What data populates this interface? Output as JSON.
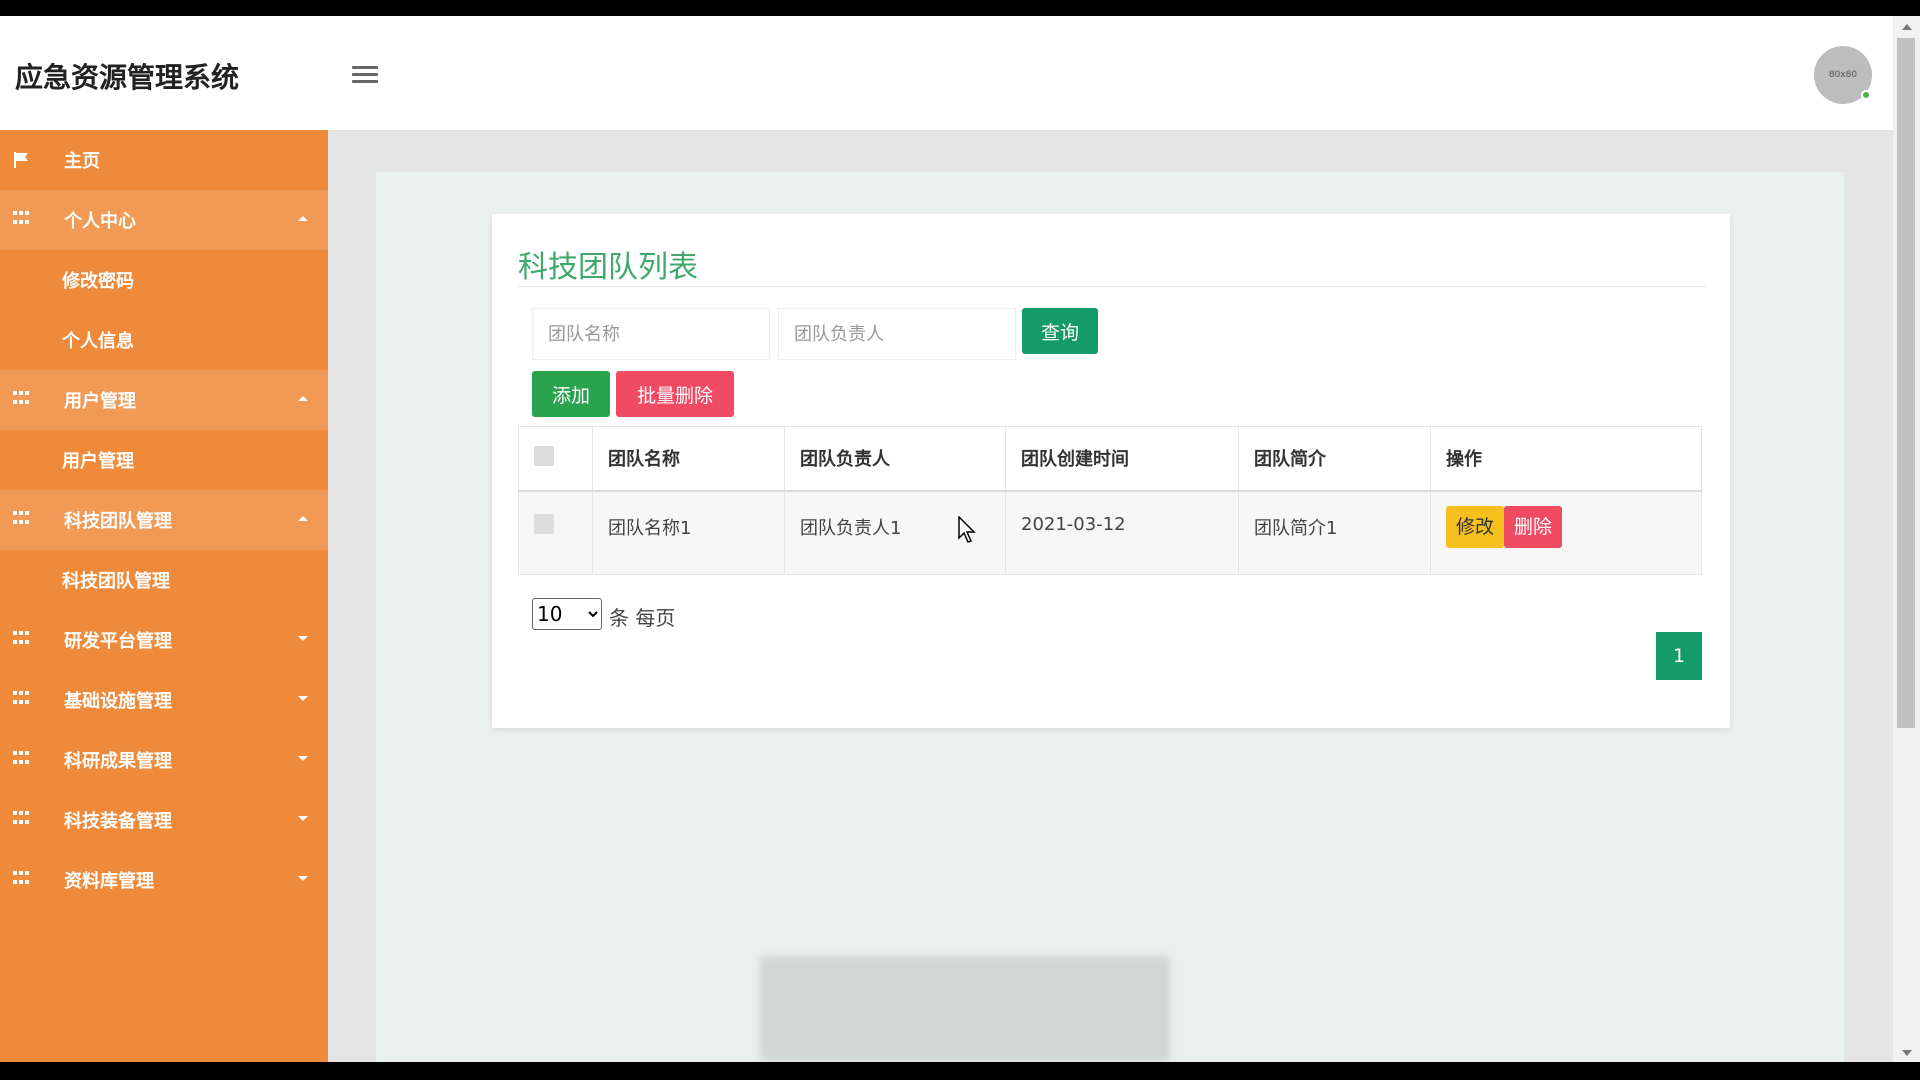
{
  "header": {
    "app_title": "应急资源管理系统",
    "avatar_text": "80x80"
  },
  "sidebar": {
    "items": [
      {
        "label": "主页",
        "icon": "flag-icon",
        "type": "top"
      },
      {
        "label": "个人中心",
        "icon": "grid-icon",
        "type": "group",
        "caret": "up"
      },
      {
        "label": "修改密码",
        "type": "sub"
      },
      {
        "label": "个人信息",
        "type": "sub"
      },
      {
        "label": "用户管理",
        "icon": "grid-icon",
        "type": "group",
        "caret": "up"
      },
      {
        "label": "用户管理",
        "type": "sub"
      },
      {
        "label": "科技团队管理",
        "icon": "grid-icon",
        "type": "group",
        "caret": "up"
      },
      {
        "label": "科技团队管理",
        "type": "sub"
      },
      {
        "label": "研发平台管理",
        "icon": "grid-icon",
        "type": "top",
        "caret": "down"
      },
      {
        "label": "基础设施管理",
        "icon": "grid-icon",
        "type": "top",
        "caret": "down"
      },
      {
        "label": "科研成果管理",
        "icon": "grid-icon",
        "type": "top",
        "caret": "down"
      },
      {
        "label": "科技装备管理",
        "icon": "grid-icon",
        "type": "top",
        "caret": "down"
      },
      {
        "label": "资料库管理",
        "icon": "grid-icon",
        "type": "top",
        "caret": "down"
      }
    ]
  },
  "main": {
    "title": "科技团队列表",
    "search": {
      "name_placeholder": "团队名称",
      "leader_placeholder": "团队负责人",
      "query_label": "查询"
    },
    "actions": {
      "add_label": "添加",
      "batch_delete_label": "批量删除"
    },
    "table": {
      "headers": [
        "团队名称",
        "团队负责人",
        "团队创建时间",
        "团队简介",
        "操作"
      ],
      "rows": [
        {
          "name": "团队名称1",
          "leader": "团队负责人1",
          "created": "2021-03-12",
          "intro": "团队简介1",
          "edit_label": "修改",
          "delete_label": "删除"
        }
      ]
    },
    "pagination": {
      "page_size": "10",
      "page_size_options": [
        "10"
      ],
      "per_page_label": "条 每页",
      "current_page": "1"
    }
  },
  "colors": {
    "sidebar_bg": "#ef8a3a",
    "sidebar_group_bg": "#f19a55",
    "title_green": "#3fa86a",
    "query_btn": "#159a6a",
    "add_btn": "#2aa34f",
    "delete_btn": "#f04b63",
    "edit_btn": "#f5bf1d"
  }
}
